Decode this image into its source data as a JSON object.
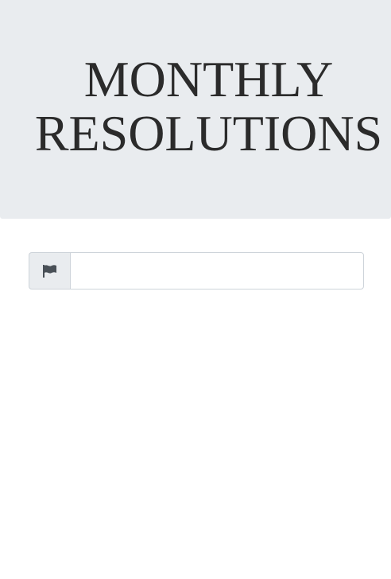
{
  "header": {
    "title_line1": "MONTHLY",
    "title_line2": "RESOLUTIONS"
  },
  "resolution_input": {
    "addon_icon": "flag-icon",
    "value": "",
    "placeholder": ""
  },
  "colors": {
    "hero_background": "#e9ecef",
    "title_text": "#2b2b2b",
    "input_border": "#ced4da",
    "icon": "#495057"
  }
}
